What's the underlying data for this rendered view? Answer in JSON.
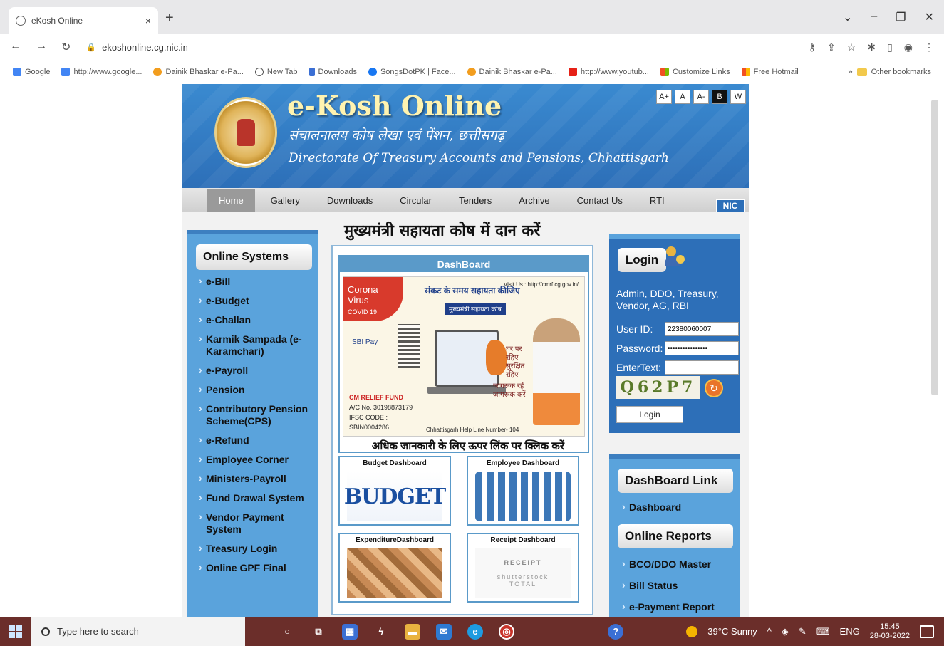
{
  "browser": {
    "tab_title": "eKosh Online",
    "url": "ekoshonline.cg.nic.in",
    "bookmarks": [
      "Google",
      "http://www.google...",
      "Dainik Bhaskar e-Pa...",
      "New Tab",
      "Downloads",
      "SongsDotPK | Face...",
      "Dainik Bhaskar e-Pa...",
      "http://www.youtub...",
      "Customize Links",
      "Free Hotmail"
    ],
    "other_bookmarks": "Other bookmarks"
  },
  "site": {
    "title": "e-Kosh Online",
    "subtitle_hindi": "संचालनालय कोष लेखा एवं पेंशन, छत्तीसगढ़",
    "subtitle_english": "Directorate Of Treasury Accounts and Pensions, Chhattisgarh",
    "font_buttons": [
      "A+",
      "A",
      "A-",
      "B",
      "W"
    ],
    "nav": [
      "Home",
      "Gallery",
      "Downloads",
      "Circular",
      "Tenders",
      "Archive",
      "Contact Us",
      "RTI"
    ],
    "nic": "NIC"
  },
  "left_panel": {
    "heading": "Online Systems",
    "items": [
      "e-Bill",
      "e-Budget",
      "e-Challan",
      "Karmik Sampada (e-Karamchari)",
      "e-Payroll",
      "Pension",
      "Contributory Pension Scheme(CPS)",
      "e-Refund",
      "Employee Corner",
      "Ministers-Payroll",
      "Fund Drawal System",
      "Vendor Payment System",
      "Treasury Login",
      "Online GPF Final"
    ]
  },
  "middle": {
    "heading": "मुख्यमंत्री सहायता कोष में दान करें",
    "dashboard_title": "DashBoard",
    "poster": {
      "corona": "Corona Virus",
      "covid": "COVID 19",
      "head": "संकट के समय सहायता कीजिए",
      "tag": "मुख्यमंत्री सहायता कोष",
      "url": "Visit Us : http://cmrf.cg.gov.in/",
      "sbi": "SBI Pay",
      "relief": "CM RELIEF FUND",
      "account": "A/C No. 30198873179",
      "ifsc": "IFSC CODE : SBIN0004286",
      "text1": "घर पर रहिए सुरक्षित रहिए",
      "text2": "जागरूक रहें जागरूक करें",
      "helpline": "Chhattisgarh Help Line Number- 104"
    },
    "caption": "अधिक जानकारी के लिए ऊपर लिंक पर क्लिक करें",
    "tiles": [
      "Budget Dashboard",
      "Employee Dashboard",
      "ExpenditureDashboard",
      "Receipt Dashboard"
    ],
    "budget_art": "BUDGET",
    "receipt_art": "RECEIPT",
    "receipt_sub": "shutterstock",
    "receipt_total": "TOTAL"
  },
  "login": {
    "heading": "Login",
    "roles": "Admin, DDO, Treasury, Vendor, AG, RBI",
    "user_label": "User ID:",
    "user_value": "22380060007",
    "password_label": "Password:",
    "password_value": "••••••••••••••••",
    "entertext_label": "EnterText:",
    "entertext_value": "",
    "captcha": "Q62P7",
    "button": "Login"
  },
  "links": {
    "dashboard_heading": "DashBoard Link",
    "dashboard_item": "Dashboard",
    "reports_heading": "Online Reports",
    "reports": [
      "BCO/DDO Master",
      "Bill Status",
      "e-Payment Report"
    ]
  },
  "taskbar": {
    "search_placeholder": "Type here to search",
    "weather": "39°C Sunny",
    "lang": "ENG",
    "time": "15:45",
    "date": "28-03-2022"
  }
}
